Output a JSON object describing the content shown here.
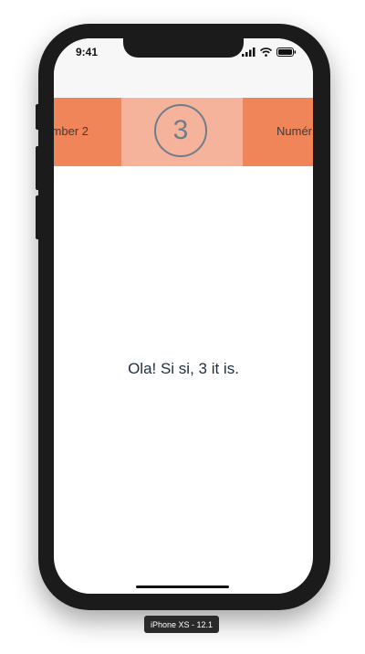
{
  "status_bar": {
    "time": "9:41",
    "icons": [
      "cellular-signal-icon",
      "wifi-icon",
      "battery-icon"
    ]
  },
  "carousel": {
    "left_label": "mber 2",
    "current_number": "3",
    "right_label": "Numér"
  },
  "content": {
    "message": "Ola! Si si, 3 it is."
  },
  "simulator": {
    "device_label": "iPhone XS - 12.1"
  },
  "colors": {
    "slide_accent": "#ef8558",
    "slide_active": "#f6b39b",
    "number_stroke": "#6f7d8a",
    "message_text": "#1f2e3d"
  }
}
